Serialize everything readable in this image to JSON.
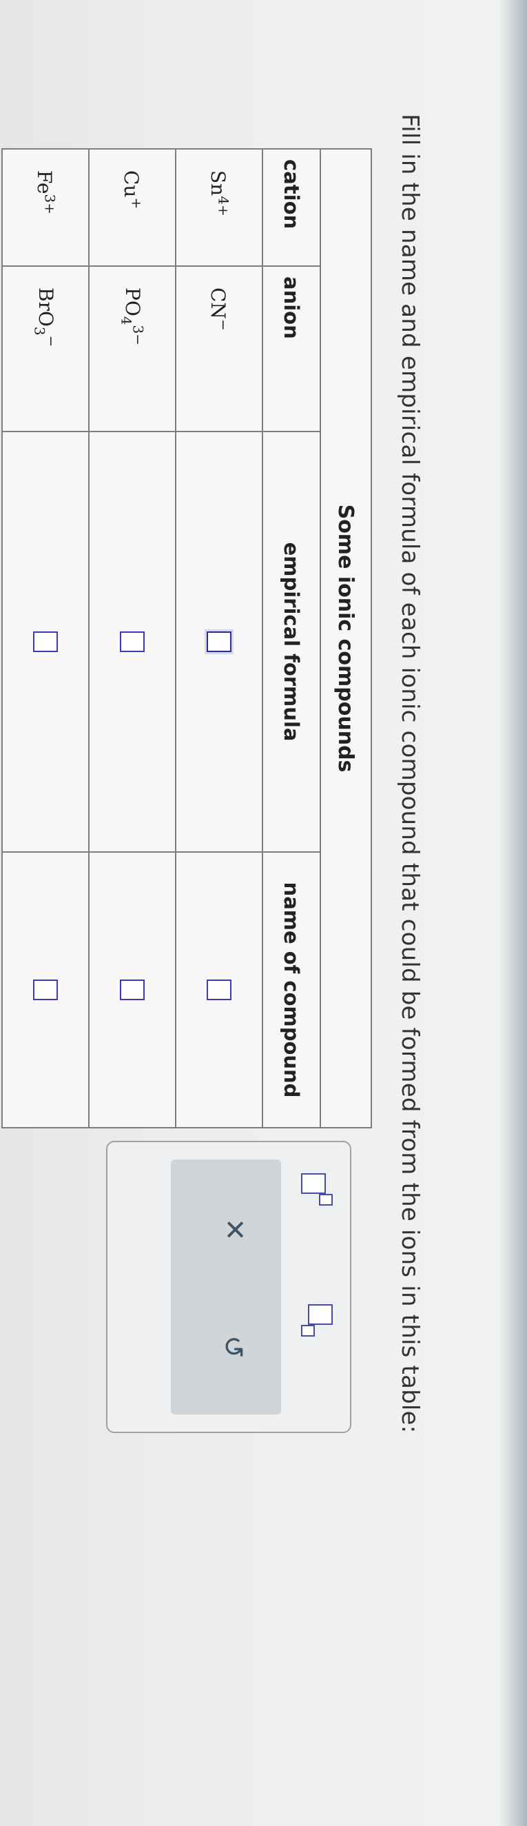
{
  "instruction": "Fill in the name and empirical formula of each ionic compound that could be formed from the ions in this table:",
  "table": {
    "caption": "Some ionic compounds",
    "headers": [
      "cation",
      "anion",
      "empirical formula",
      "name of compound"
    ],
    "rows": [
      {
        "cation": {
          "base": "Sn",
          "charge": "4+"
        },
        "anion": {
          "base": "CN",
          "charge": "−",
          "subscript": ""
        },
        "empirical_formula": "",
        "name": ""
      },
      {
        "cation": {
          "base": "Cu",
          "charge": "+"
        },
        "anion": {
          "base": "PO",
          "charge": "3−",
          "subscript": "4"
        },
        "empirical_formula": "",
        "name": ""
      },
      {
        "cation": {
          "base": "Fe",
          "charge": "3+"
        },
        "anion": {
          "base": "BrO",
          "charge": "−",
          "subscript": "3"
        },
        "empirical_formula": "",
        "name": ""
      }
    ]
  },
  "toolbar": {
    "superscript_icon": "superscript-box-icon",
    "subscript_icon": "subscript-box-icon",
    "clear_glyph": "✕",
    "undo_glyph": "↺"
  },
  "colors": {
    "input_box_border": "#3a3ab5",
    "tool_icon": "#3d5366"
  }
}
